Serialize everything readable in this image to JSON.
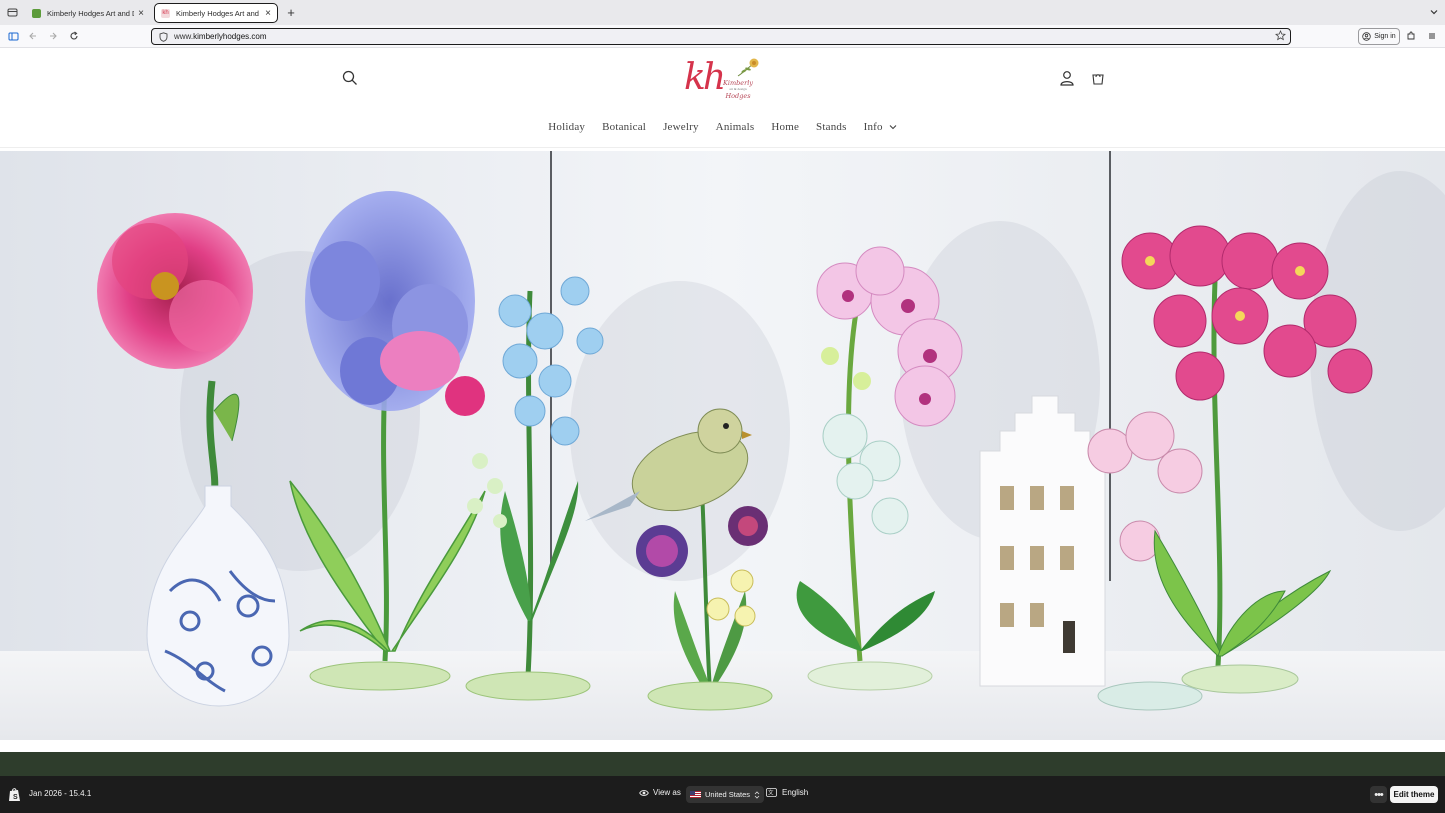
{
  "browser": {
    "tabs": [
      {
        "title": "Kimberly Hodges Art and Design",
        "active": false
      },
      {
        "title": "Kimberly Hodges Art and Design",
        "active": true
      }
    ],
    "url_prefix": "www.",
    "url_domain": "kimberlyhodges.com",
    "sign_in_label": "Sign in"
  },
  "site": {
    "logo": {
      "monogram": "kh",
      "name_top": "Kimberly",
      "tagline": "art & design",
      "name_bottom": "Hodges"
    },
    "nav": [
      {
        "label": "Holiday"
      },
      {
        "label": "Botanical"
      },
      {
        "label": "Jewelry"
      },
      {
        "label": "Animals"
      },
      {
        "label": "Home"
      },
      {
        "label": "Stands"
      },
      {
        "label": "Info",
        "has_dropdown": true
      }
    ],
    "hero": {
      "description_icons": [
        "peony",
        "orchid",
        "delphinium",
        "bird",
        "clover",
        "orchid",
        "house",
        "orchid"
      ]
    },
    "accent_color": "#2e3d2c",
    "logo_color": "#d5334b"
  },
  "editor": {
    "version": "Jan 2026 - 15.4.1",
    "view_as_label": "View as",
    "country": "United States",
    "language": "English",
    "more_label": "•••",
    "edit_button": "Edit theme"
  }
}
